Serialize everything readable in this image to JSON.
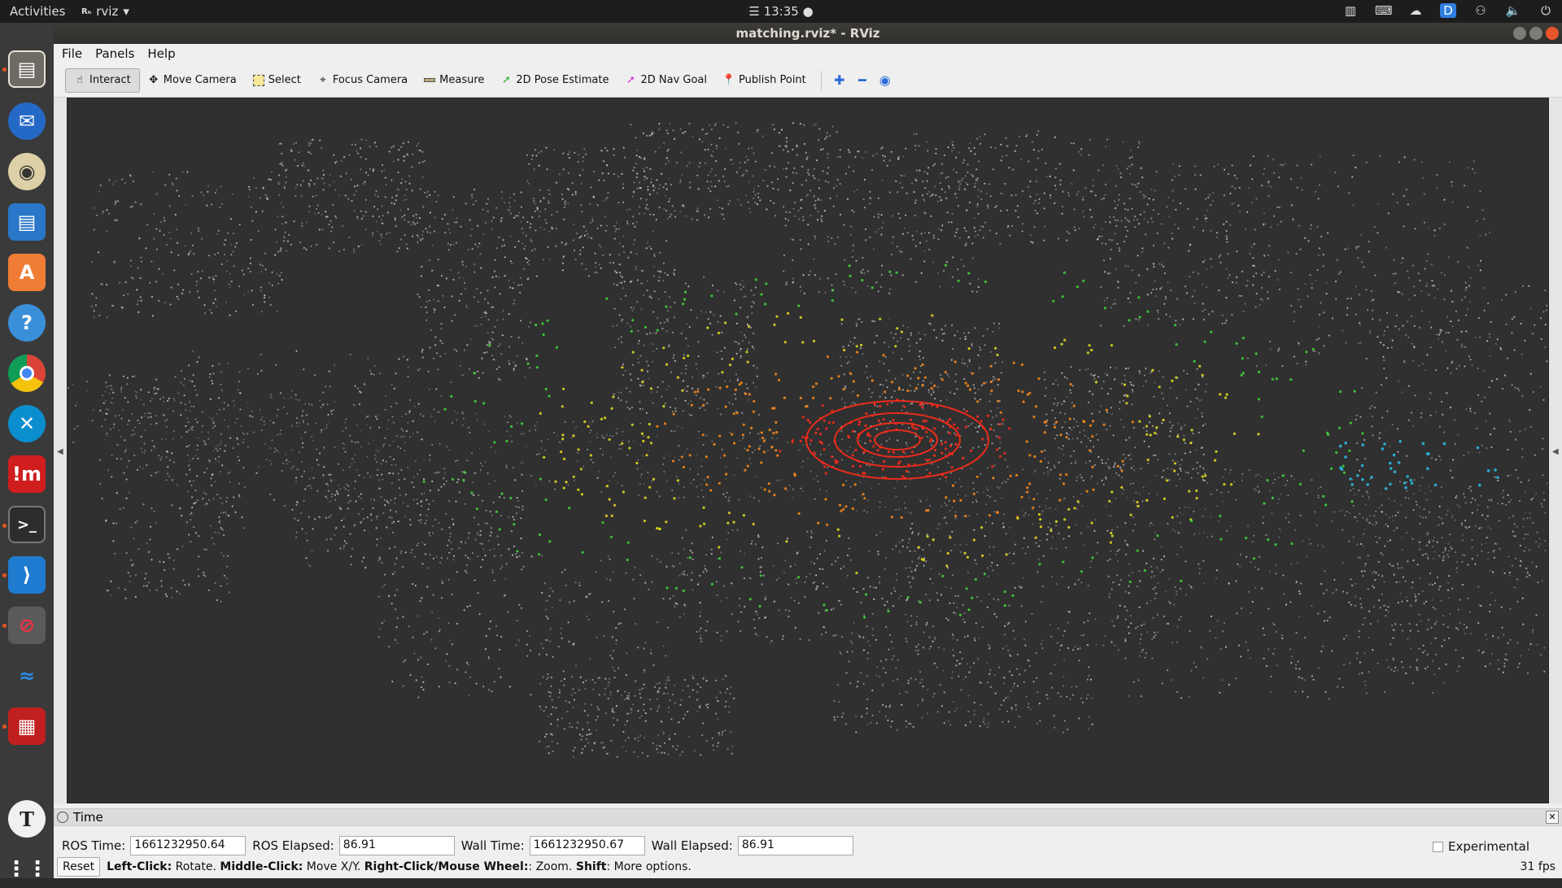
{
  "topbar": {
    "activities": "Activities",
    "app_name": "rviz",
    "app_badge": "Rₕ",
    "clock": "13:35"
  },
  "window": {
    "title": "matching.rviz* - RViz"
  },
  "menu": [
    "File",
    "Panels",
    "Help"
  ],
  "toolbar": {
    "tools": [
      {
        "label": "Interact",
        "icon": "hand-icon",
        "active": true
      },
      {
        "label": "Move Camera",
        "icon": "move-icon",
        "active": false
      },
      {
        "label": "Select",
        "icon": "select-icon",
        "active": false
      },
      {
        "label": "Focus Camera",
        "icon": "focus-icon",
        "active": false
      },
      {
        "label": "Measure",
        "icon": "ruler-icon",
        "active": false
      },
      {
        "label": "2D Pose Estimate",
        "icon": "green-arrow-icon",
        "active": false
      },
      {
        "label": "2D Nav Goal",
        "icon": "pink-arrow-icon",
        "active": false
      },
      {
        "label": "Publish Point",
        "icon": "pin-icon",
        "active": false
      }
    ]
  },
  "time_panel": {
    "title": "Time",
    "ros_time_label": "ROS Time:",
    "ros_time": "1661232950.64",
    "ros_elapsed_label": "ROS Elapsed:",
    "ros_elapsed": "86.91",
    "wall_time_label": "Wall Time:",
    "wall_time": "1661232950.67",
    "wall_elapsed_label": "Wall Elapsed:",
    "wall_elapsed": "86.91",
    "experimental": "Experimental"
  },
  "status": {
    "reset": "Reset",
    "left_click": "Left-Click:",
    "left_click_action": " Rotate. ",
    "middle_click": "Middle-Click:",
    "middle_click_action": " Move X/Y. ",
    "right_click": "Right-Click/Mouse Wheel:",
    "right_click_action": ": Zoom. ",
    "shift": "Shift",
    "shift_action": ": More options.",
    "fps": "31 fps"
  },
  "colors": {
    "pointcloud": "#d8d8d8",
    "scan_red": "#ff2a1a",
    "scan_orange": "#ff8a1a",
    "scan_yellow": "#e8e020",
    "scan_green": "#3fd83a",
    "scan_cyan": "#2ab8e0"
  }
}
